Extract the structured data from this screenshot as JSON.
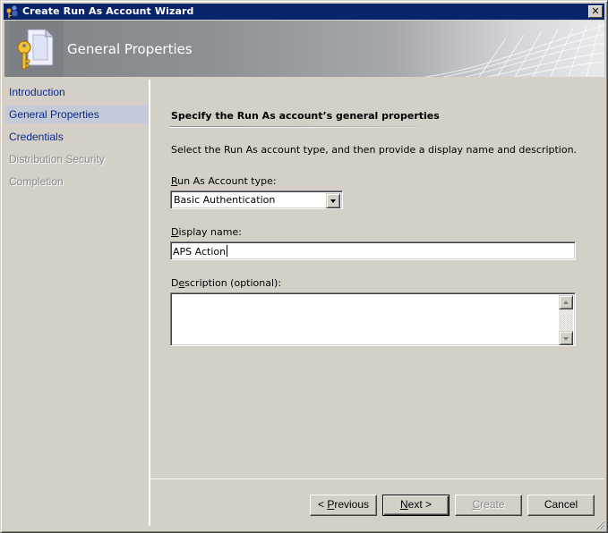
{
  "window": {
    "title": "Create Run As Account Wizard",
    "app_icon": "key-users-icon",
    "close_label": "✕"
  },
  "banner": {
    "title": "General Properties",
    "icon": "key-document-icon"
  },
  "nav": {
    "items": [
      {
        "label": "Introduction",
        "state": "enabled"
      },
      {
        "label": "General Properties",
        "state": "current"
      },
      {
        "label": "Credentials",
        "state": "enabled"
      },
      {
        "label": "Distribution Security",
        "state": "disabled"
      },
      {
        "label": "Completion",
        "state": "disabled"
      }
    ]
  },
  "content": {
    "heading": "Specify the Run As account’s general properties",
    "description": "Select the Run As account type, and then provide a display name and description.",
    "account_type": {
      "label_mnemonic": "R",
      "label_rest": "un As Account type:",
      "value": "Basic Authentication"
    },
    "display_name": {
      "label_mnemonic": "D",
      "label_rest": "isplay name:",
      "value": "APS Action"
    },
    "description_field": {
      "label_pre": "D",
      "label_mnemonic": "e",
      "label_rest": "scription (optional):",
      "value": ""
    }
  },
  "buttons": {
    "previous": {
      "pre": "< ",
      "mnemonic": "P",
      "rest": "revious",
      "enabled": true
    },
    "next": {
      "pre": "",
      "mnemonic": "N",
      "rest": "ext >",
      "enabled": true
    },
    "create": {
      "pre": "",
      "mnemonic": "C",
      "rest": "reate",
      "enabled": false
    },
    "cancel": {
      "label": "Cancel",
      "enabled": true
    }
  }
}
